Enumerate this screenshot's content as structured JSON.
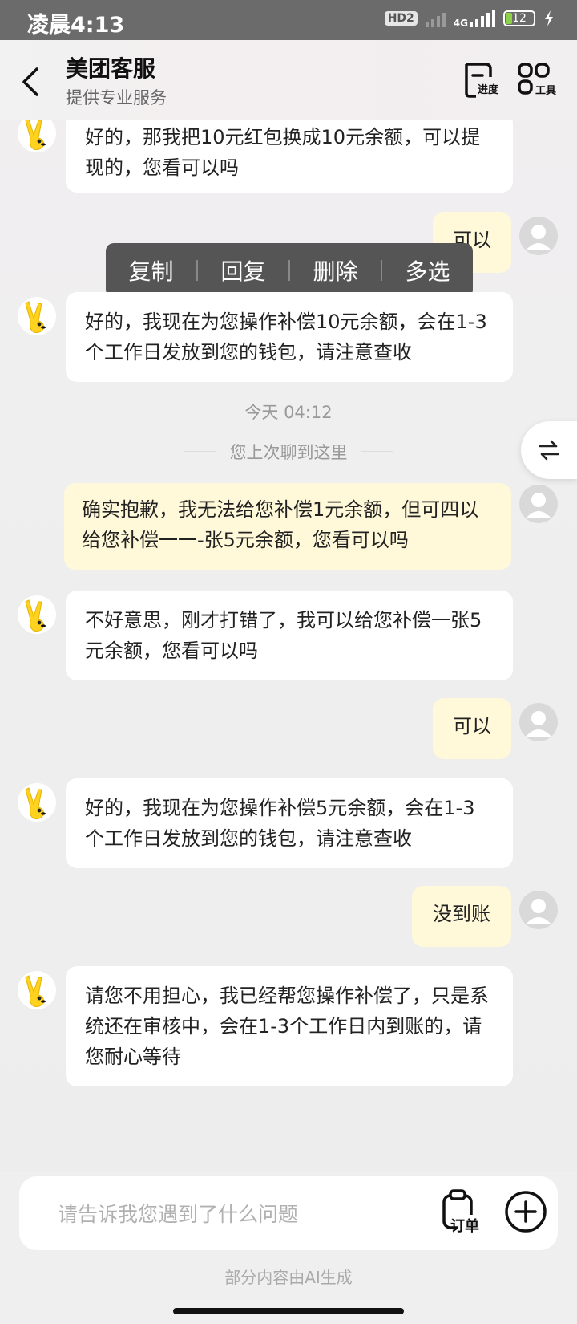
{
  "status_bar": {
    "time": "凌晨4:13",
    "hd": "HD2",
    "network": "4G",
    "battery": "12"
  },
  "header": {
    "title": "美团客服",
    "subtitle": "提供专业服务",
    "progress_label": "进度",
    "tools_label": "工具"
  },
  "context_menu": {
    "items": [
      "复制",
      "回复",
      "删除",
      "多选"
    ]
  },
  "messages": [
    {
      "from": "bot",
      "text": "好的，那我把10元红包换成10元余额，可以提现的，您看可以吗"
    },
    {
      "from": "user",
      "text": "可以"
    },
    {
      "from": "bot",
      "text": "好的，我现在为您操作补偿10元余额，会在1-3个工作日发放到您的钱包，请注意查收"
    },
    {
      "from": "user",
      "text": "确实抱歉，我无法给您补偿1元余额，但可四以给您补偿一一-张5元余额，您看可以吗"
    },
    {
      "from": "bot",
      "text": "不好意思，刚才打错了，我可以给您补偿一张5元余额，您看可以吗"
    },
    {
      "from": "user",
      "text": "可以"
    },
    {
      "from": "bot",
      "text": "好的，我现在为您操作补偿5元余额，会在1-3个工作日发放到您的钱包，请注意查收"
    },
    {
      "from": "user",
      "text": "没到账"
    },
    {
      "from": "bot",
      "text": "请您不用担心，我已经帮您操作补偿了，只是系统还在审核中，会在1-3个工作日内到账的，请您耐心等待"
    }
  ],
  "timestamp": "今天 04:12",
  "last_read": "您上次聊到这里",
  "input": {
    "placeholder": "请告诉我您遇到了什么问题",
    "order_label": "订单"
  },
  "footer_note": "部分内容由AI生成",
  "colors": {
    "user_bubble": "#fff9d9",
    "bot_bubble": "#ffffff",
    "mascot_yellow": "#ffd21f"
  }
}
